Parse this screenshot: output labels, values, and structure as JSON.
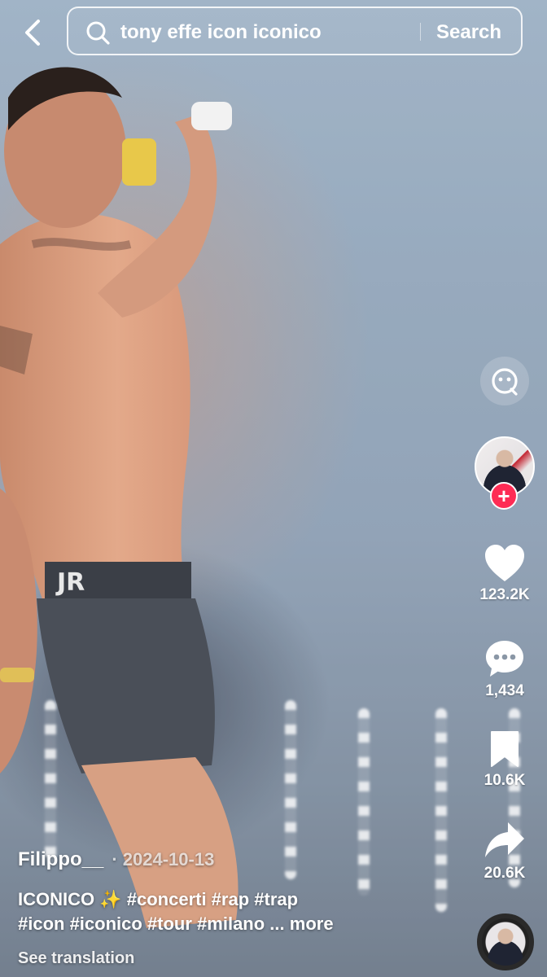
{
  "search": {
    "query": "tony effe icon iconico",
    "button_label": "Search"
  },
  "rail": {
    "likes": "123.2K",
    "comments": "1,434",
    "saves": "10.6K",
    "shares": "20.6K"
  },
  "post": {
    "author": "Filippo__",
    "date": "· 2024-10-13",
    "caption_line1_text": "ICONICO ",
    "caption_emoji": "✨",
    "caption_line1_tags": " #concerti #rap #trap",
    "caption_line2_tags": "#icon #iconico #tour #milano ...",
    "more_label": " more",
    "see_translation": "See translation"
  },
  "icons": {
    "back": "chevron-left-icon",
    "search": "search-icon",
    "inline_search": "smiley-search-icon",
    "like": "heart-icon",
    "comment": "comment-bubble-icon",
    "save": "bookmark-icon",
    "share": "share-arrow-icon"
  },
  "colors": {
    "follow_accent": "#fe2c55",
    "text": "#ffffff"
  }
}
